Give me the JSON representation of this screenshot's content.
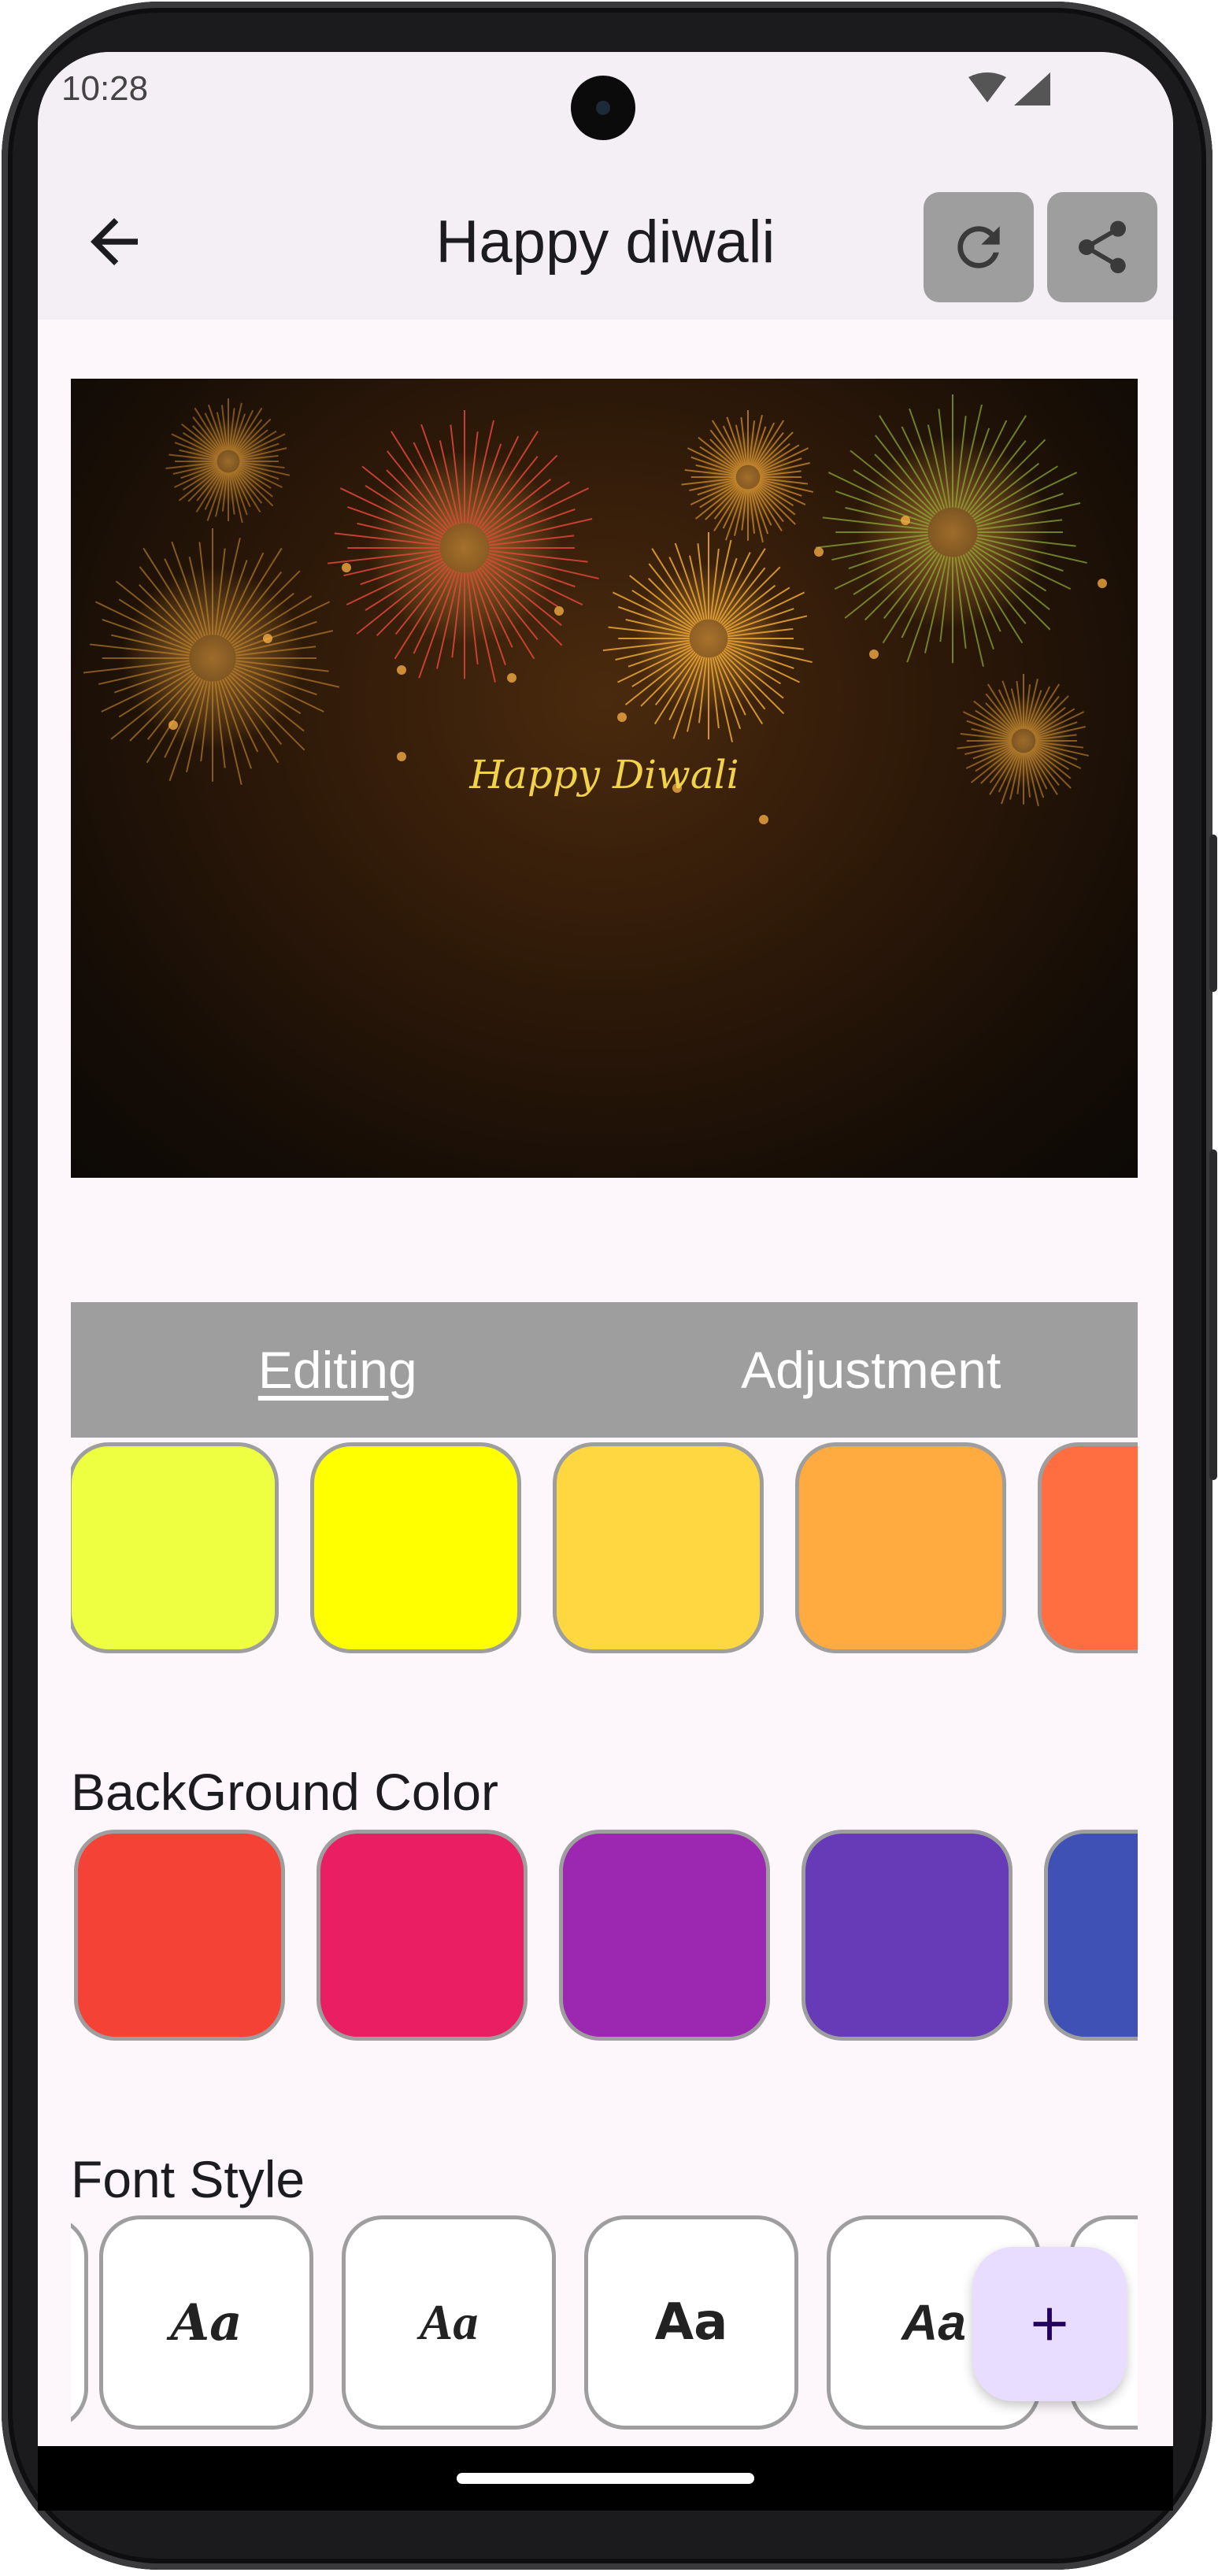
{
  "status_bar": {
    "time": "10:28"
  },
  "app_bar": {
    "title": "Happy diwali",
    "back_icon": "arrow-back-icon",
    "refresh_icon": "refresh-icon",
    "share_icon": "share-icon"
  },
  "preview": {
    "greeting": "Happy Diwali"
  },
  "tabs": [
    {
      "label": "Editing",
      "active": true
    },
    {
      "label": "Adjustment",
      "active": false
    }
  ],
  "text_colors": [
    "#eeff41",
    "#ffff00",
    "#ffd740",
    "#ffab40",
    "#ff6e40"
  ],
  "background_section": {
    "label": "BackGround Color",
    "colors": [
      "#f44336",
      "#e91e63",
      "#9c27b0",
      "#673ab7",
      "#3f51b5"
    ]
  },
  "font_section": {
    "label": "Font Style",
    "samples": [
      "Aa",
      "Aa",
      "Aa",
      "Aa"
    ]
  },
  "fab": {
    "icon": "plus-icon"
  }
}
